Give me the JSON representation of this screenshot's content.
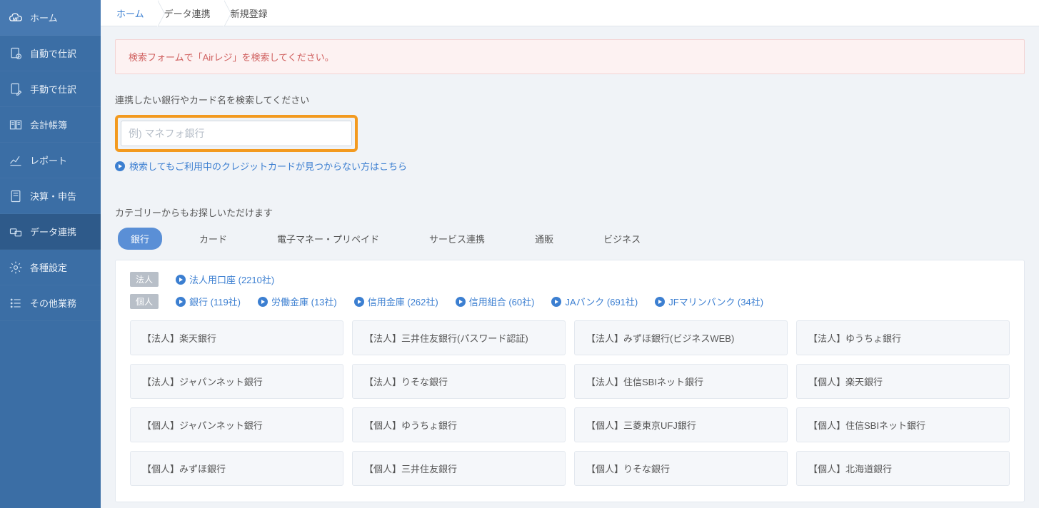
{
  "sidebar": {
    "items": [
      {
        "label": "ホーム"
      },
      {
        "label": "自動で仕訳"
      },
      {
        "label": "手動で仕訳"
      },
      {
        "label": "会計帳簿"
      },
      {
        "label": "レポート"
      },
      {
        "label": "決算・申告"
      },
      {
        "label": "データ連携"
      },
      {
        "label": "各種設定"
      },
      {
        "label": "その他業務"
      }
    ]
  },
  "breadcrumb": {
    "items": [
      "ホーム",
      "データ連携",
      "新規登録"
    ]
  },
  "alert": "検索フォームで「Airレジ」を検索してください。",
  "search": {
    "label": "連携したい銀行やカード名を検索してください",
    "placeholder": "例) マネフォ銀行",
    "help_link": "検索してもご利用中のクレジットカードが見つからない方はこちら"
  },
  "category_label": "カテゴリーからもお探しいただけます",
  "tabs": [
    "銀行",
    "カード",
    "電子マネー・プリペイド",
    "サービス連携",
    "通販",
    "ビジネス"
  ],
  "tags": {
    "corp_badge": "法人",
    "corp_links": [
      "法人用口座 (2210社)"
    ],
    "indiv_badge": "個人",
    "indiv_links": [
      "銀行 (119社)",
      "労働金庫 (13社)",
      "信用金庫 (262社)",
      "信用組合 (60社)",
      "JAバンク (691社)",
      "JFマリンバンク (34社)"
    ]
  },
  "cards": [
    "【法人】楽天銀行",
    "【法人】三井住友銀行(パスワード認証)",
    "【法人】みずほ銀行(ビジネスWEB)",
    "【法人】ゆうちょ銀行",
    "【法人】ジャパンネット銀行",
    "【法人】りそな銀行",
    "【法人】住信SBIネット銀行",
    "【個人】楽天銀行",
    "【個人】ジャパンネット銀行",
    "【個人】ゆうちょ銀行",
    "【個人】三菱東京UFJ銀行",
    "【個人】住信SBIネット銀行",
    "【個人】みずほ銀行",
    "【個人】三井住友銀行",
    "【個人】りそな銀行",
    "【個人】北海道銀行"
  ]
}
